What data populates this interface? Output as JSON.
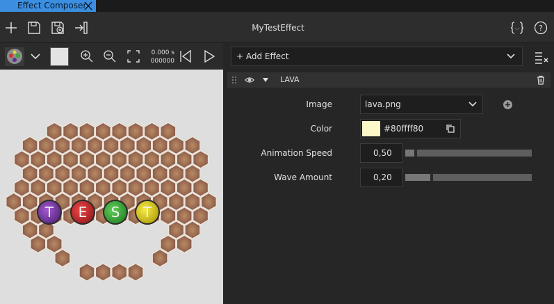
{
  "tab": {
    "title": "Effect Composer"
  },
  "toolbar": {
    "title": "MyTestEffect"
  },
  "preview": {
    "time_seconds": "0.000 s",
    "time_frames": "000000",
    "letters": [
      "T",
      "E",
      "S",
      "T"
    ]
  },
  "effects": {
    "add_label": "+ Add Effect",
    "node": {
      "name": "LAVA",
      "properties": {
        "image": {
          "label": "Image",
          "value": "lava.png"
        },
        "color": {
          "label": "Color",
          "value": "#80ffff80",
          "swatch": "#fdf8c8"
        },
        "speed": {
          "label": "Animation Speed",
          "value": "0,50",
          "fraction": 0.07
        },
        "wave": {
          "label": "Wave Amount",
          "value": "0,20",
          "fraction": 0.2
        }
      }
    }
  },
  "colors": {
    "accent": "#3b8ee0",
    "panel": "#262626",
    "canvas": "#dedede"
  }
}
